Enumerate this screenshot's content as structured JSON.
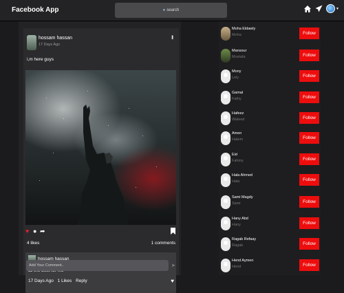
{
  "app": {
    "title": "Facebook App"
  },
  "search": {
    "placeholder": "search"
  },
  "post": {
    "author": "hossam hassan",
    "time": "17 Days Ago",
    "text": "i,m here guys",
    "likes": "4 likes",
    "comments": "1 comments",
    "comment": {
      "author": "hossam hassan",
      "text": "all the best for me",
      "time": "17 Days Ago",
      "likes": "1 Likes",
      "reply": "Reply"
    },
    "add_comment_placeholder": "Add Your Comment.."
  },
  "suggestions": [
    {
      "name": "Moha Eldawly",
      "username": "Moha",
      "follow": "Follow"
    },
    {
      "name": "Mansour",
      "username": "Mostafa",
      "follow": "Follow"
    },
    {
      "name": "Mony",
      "username": "Lely",
      "follow": "Follow"
    },
    {
      "name": "Gamal",
      "username": "Fathy",
      "follow": "Follow"
    },
    {
      "name": "Hafeez",
      "username": "Waleed",
      "follow": "Follow"
    },
    {
      "name": "Amen",
      "username": "Hatem",
      "follow": "Follow"
    },
    {
      "name": "Eid",
      "username": "Fahmy",
      "follow": "Follow"
    },
    {
      "name": "Hala Ahmed",
      "username": "Hala",
      "follow": "Follow"
    },
    {
      "name": "Sami Magdy",
      "username": "Sami",
      "follow": "Follow"
    },
    {
      "name": "Hany Abd",
      "username": "Hany",
      "follow": "Follow"
    },
    {
      "name": "Ragab Refaay",
      "username": "Ragab",
      "follow": "Follow"
    },
    {
      "name": "Hend Aymen",
      "username": "Hend",
      "follow": "Follow"
    }
  ],
  "icons": {
    "home": "home-icon",
    "send": "send-icon",
    "profile": "globe-avatar-icon",
    "like": "heart-icon",
    "comment": "comment-icon",
    "share": "share-icon",
    "bookmark": "bookmark-icon"
  },
  "colors": {
    "background": "#1b1b1d",
    "topbar": "#232325",
    "follow_button": "#ee0d0d",
    "like_active": "#e0202a"
  }
}
